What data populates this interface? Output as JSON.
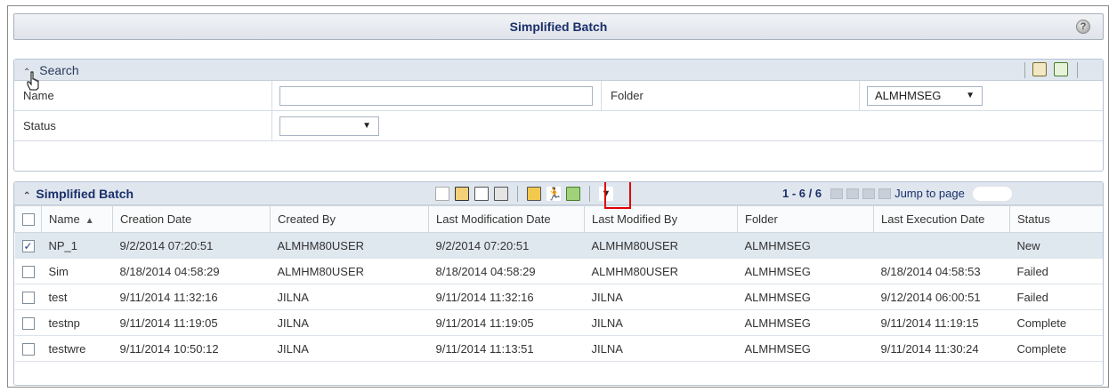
{
  "window": {
    "title": "Simplified Batch",
    "help_icon": "?"
  },
  "search": {
    "title": "Search",
    "fields": {
      "name_label": "Name",
      "name_value": "",
      "folder_label": "Folder",
      "folder_value": "ALMHMSEG",
      "status_label": "Status",
      "status_value": ""
    },
    "icons": [
      "search-icon",
      "refresh-icon"
    ]
  },
  "grid": {
    "title": "Simplified Batch",
    "pager": {
      "range": "1 - 6 / 6",
      "jump_label": "Jump to page"
    },
    "toolbar_icons": [
      "add-icon",
      "view-icon",
      "edit-icon",
      "delete-icon",
      "save-icon",
      "run-icon",
      "refresh-icon",
      "filter-icon"
    ],
    "columns": [
      "Name",
      "Creation Date",
      "Created By",
      "Last Modification Date",
      "Last Modified By",
      "Folder",
      "Last Execution Date",
      "Status"
    ],
    "rows": [
      {
        "checked": true,
        "name": "NP_1",
        "created": "9/2/2014 07:20:51",
        "by": "ALMHM80USER",
        "modified": "9/2/2014 07:20:51",
        "mod_by": "ALMHM80USER",
        "folder": "ALMHMSEG",
        "exec": "",
        "status": "New"
      },
      {
        "checked": false,
        "name": "Sim",
        "created": "8/18/2014 04:58:29",
        "by": "ALMHM80USER",
        "modified": "8/18/2014 04:58:29",
        "mod_by": "ALMHM80USER",
        "folder": "ALMHMSEG",
        "exec": "8/18/2014 04:58:53",
        "status": "Failed"
      },
      {
        "checked": false,
        "name": "test",
        "created": "9/11/2014 11:32:16",
        "by": "JILNA",
        "modified": "9/11/2014 11:32:16",
        "mod_by": "JILNA",
        "folder": "ALMHMSEG",
        "exec": "9/12/2014 06:00:51",
        "status": "Failed"
      },
      {
        "checked": false,
        "name": "testnp",
        "created": "9/11/2014 11:19:05",
        "by": "JILNA",
        "modified": "9/11/2014 11:19:05",
        "mod_by": "JILNA",
        "folder": "ALMHMSEG",
        "exec": "9/11/2014 11:19:15",
        "status": "Complete"
      },
      {
        "checked": false,
        "name": "testwre",
        "created": "9/11/2014 10:50:12",
        "by": "JILNA",
        "modified": "9/11/2014 11:13:51",
        "mod_by": "JILNA",
        "folder": "ALMHMSEG",
        "exec": "9/11/2014 11:30:24",
        "status": "Complete"
      }
    ]
  }
}
